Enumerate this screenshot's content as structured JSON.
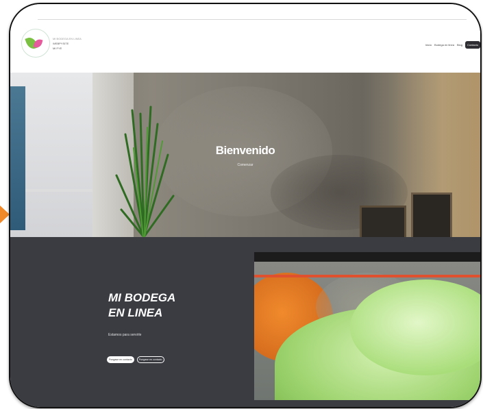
{
  "brand": {
    "line1": "MI BODEGA EN LINEA",
    "line2": "WEBPYSITE",
    "line3": "MI FYE"
  },
  "nav": {
    "items": [
      "Inicio",
      "Bodega en linea",
      "Blog"
    ],
    "contact": "Contacto"
  },
  "hero": {
    "title": "Bienvenido",
    "subtitle": "Comenzar"
  },
  "feature": {
    "title_line1": "MI BODEGA",
    "title_line2": "EN LINEA",
    "subtitle": "Estamos para servirle",
    "button_primary": "Pongase en contacto",
    "button_secondary": "Pongase en contacto"
  },
  "colors": {
    "accent_arrow": "#f0892a",
    "dark_section": "#3a3c42",
    "contact_button": "#2f2f33"
  }
}
